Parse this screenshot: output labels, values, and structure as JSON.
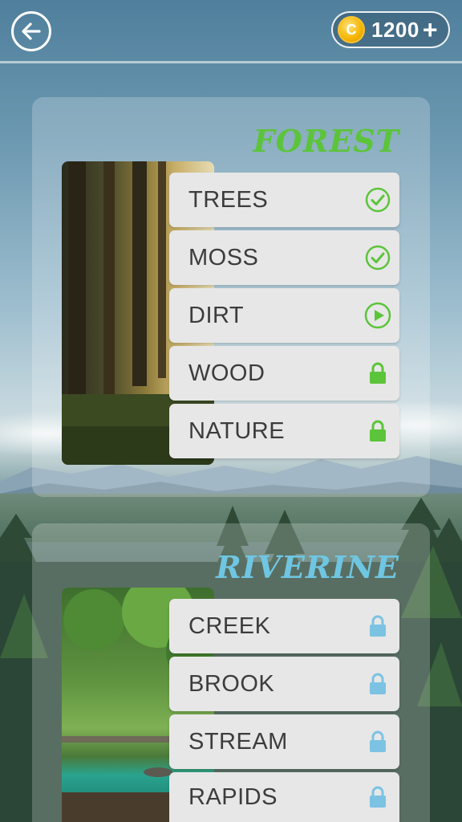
{
  "header": {
    "coins": "1200",
    "coin_symbol": "C",
    "plus_symbol": "+"
  },
  "colors": {
    "forest_title": "#5cc43a",
    "riverine_title": "#6fc6e2",
    "check_green": "#5cc43a",
    "lock_green": "#5cc43a",
    "lock_blue": "#7cc3e3"
  },
  "categories": [
    {
      "title": "FOREST",
      "levels": [
        {
          "label": "TREES",
          "status": "completed",
          "icon": "check-icon"
        },
        {
          "label": "MOSS",
          "status": "completed",
          "icon": "check-icon"
        },
        {
          "label": "DIRT",
          "status": "current",
          "icon": "play-icon"
        },
        {
          "label": "WOOD",
          "status": "locked",
          "icon": "lock-icon"
        },
        {
          "label": "NATURE",
          "status": "locked",
          "icon": "lock-icon"
        }
      ]
    },
    {
      "title": "RIVERINE",
      "levels": [
        {
          "label": "CREEK",
          "status": "locked",
          "icon": "lock-icon"
        },
        {
          "label": "BROOK",
          "status": "locked",
          "icon": "lock-icon"
        },
        {
          "label": "STREAM",
          "status": "locked",
          "icon": "lock-icon"
        },
        {
          "label": "RAPIDS",
          "status": "locked",
          "icon": "lock-icon"
        }
      ]
    }
  ]
}
